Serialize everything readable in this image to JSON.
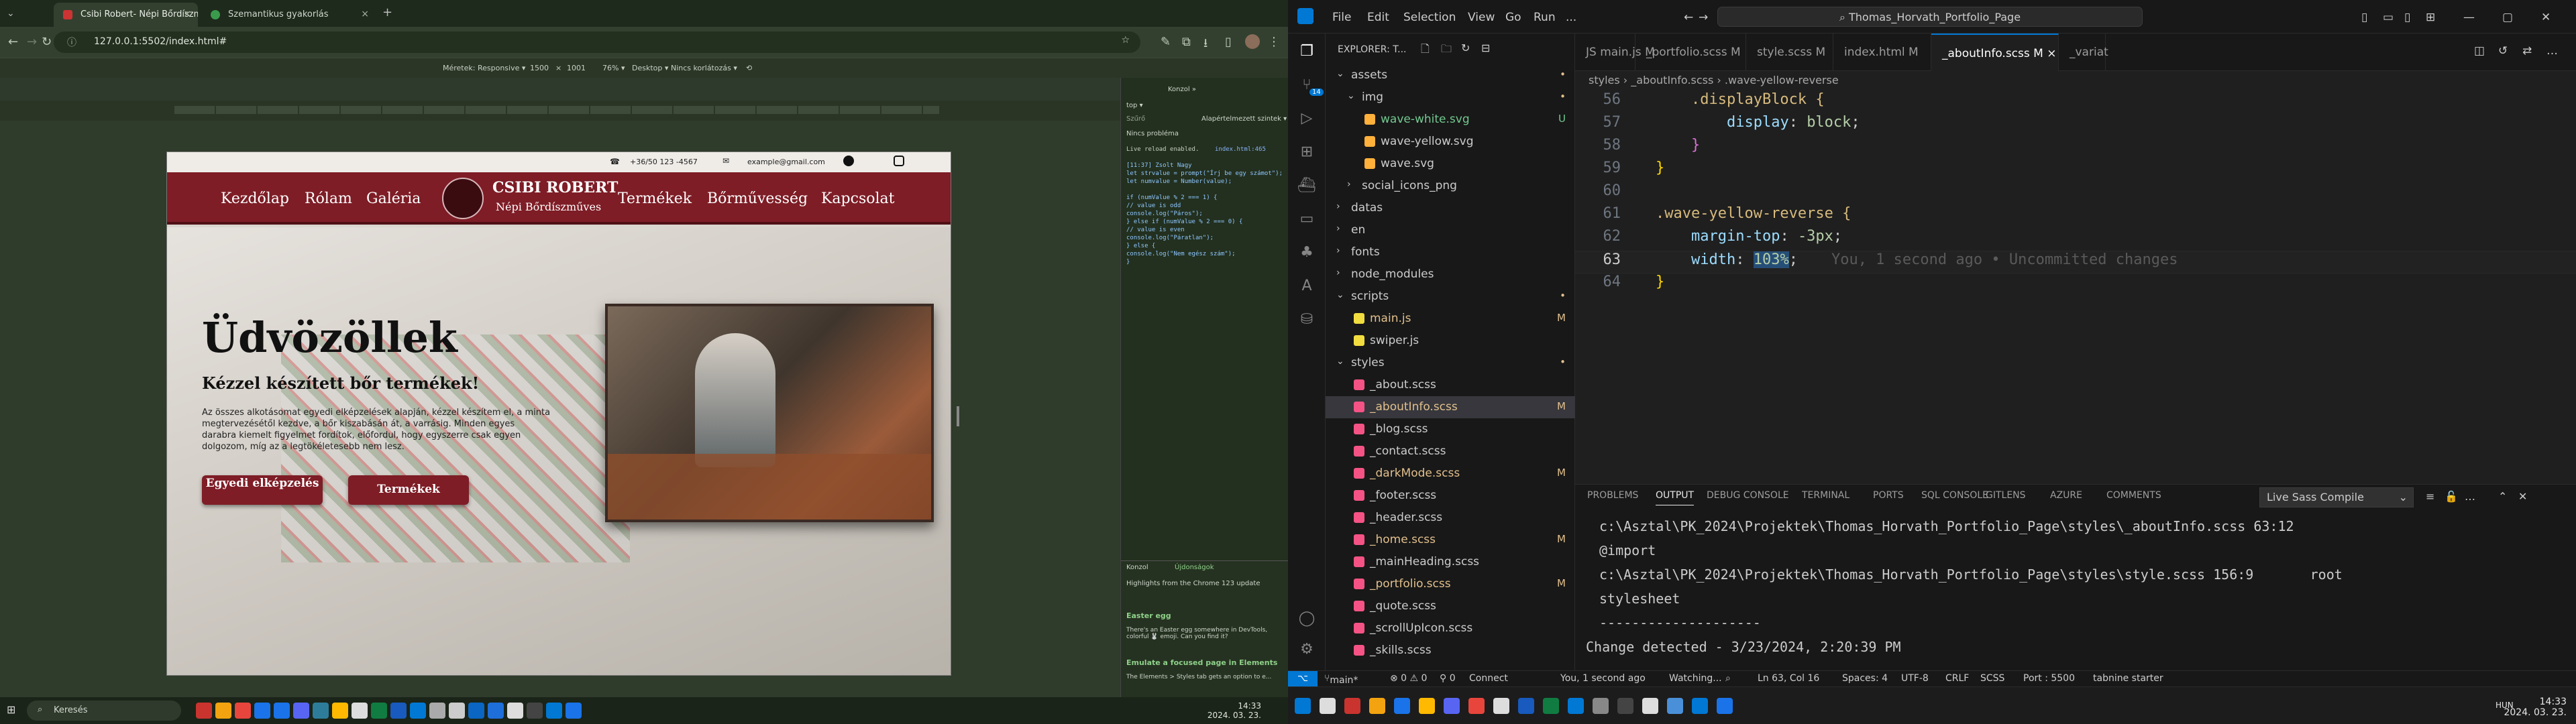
{
  "left": {
    "tabs": [
      {
        "label": "Csibi Robert- Népi Bőrdíszmű...",
        "active": true
      },
      {
        "label": "Szemantikus gyakorlás",
        "active": false
      }
    ],
    "address": "127.0.0.1:5502/index.html#",
    "devbar": {
      "dimensions": "Méretek: Responsive ▾",
      "width": "1500",
      "x": "×",
      "height": "1001",
      "zoom": "76% ▾",
      "device": "Desktop ▾",
      "throttle": "Nincs korlátozás ▾"
    },
    "website": {
      "phone": "+36/50 123 -4567",
      "email": "example@gmail.com",
      "nav": [
        "Kezdőlap",
        "Rólam",
        "Galéria",
        "Termékek",
        "Bőrművesség",
        "Kapcsolat"
      ],
      "logo_title": "CSIBI ROBERT",
      "logo_sub": "Népi Bőrdíszműves",
      "hero_title": "Üdvözöllek",
      "hero_subtitle": "Kézzel készített bőr termékek!",
      "hero_text": "Az összes alkotásomat egyedi elképzelések alapján, kézzel készítem el, a minta megtervezésétől kezdve, a bőr kiszabásán át, a varrásig. Minden egyes darabra kiemelt figyelmet fordítok, előfordul, hogy egyszerre csak egyen dolgozom, míg az a legtökéletesebb nem lesz.",
      "btn1": "Egyedi elképzelés",
      "btn2": "Termékek"
    },
    "devtools": {
      "tabs": "Konzol   »",
      "top": "top ▾",
      "filter": "Szűrő",
      "level": "Alapértelmezett szintek ▾",
      "issues": "Nincs probléma",
      "console": [
        "Live reload enabled.",
        "index.html:465",
        "[11:37] Zsolt Nagy",
        "let strvalue = prompt(\"Írj be egy számot\");",
        "let numvalue = Number(value);",
        "",
        "if (numValue % 2 === 1) {",
        "    // value is odd",
        "    console.log(\"Páros\");",
        "} else if (numValue % 2 === 0) {",
        "    // value is even",
        "    console.log(\"Páratlan\");",
        "} else {",
        "    console.log(\"Nem egész szám\");",
        "}"
      ],
      "bottom_tabs": [
        "Konzol",
        "Újdonságok"
      ],
      "bottom_head": "Highlights from the Chrome 123 update",
      "easter_title": "Easter egg",
      "easter_text": "There's an Easter egg somewhere in DevTools, colorful 🐰 emoji. Can you find it?",
      "emulate_title": "Emulate a focused page in Elements",
      "emulate_text": "The Elements > Styles tab gets an option to e..."
    },
    "taskbar": {
      "search": "Keresés",
      "time": "14:33",
      "date": "2024. 03. 23."
    }
  },
  "right": {
    "menu": [
      "File",
      "Edit",
      "Selection",
      "View",
      "Go",
      "Run",
      "..."
    ],
    "command_center": "Thomas_Horvath_Portfolio_Page",
    "explorer_title": "EXPLORER: T...",
    "tree": [
      {
        "label": "assets",
        "depth": 0,
        "type": "folder-open",
        "status": "•"
      },
      {
        "label": "img",
        "depth": 1,
        "type": "folder-open",
        "status": "•"
      },
      {
        "label": "wave-white.svg",
        "depth": 2,
        "type": "svg",
        "status": "U"
      },
      {
        "label": "wave-yellow.svg",
        "depth": 2,
        "type": "svg",
        "status": ""
      },
      {
        "label": "wave.svg",
        "depth": 2,
        "type": "svg",
        "status": ""
      },
      {
        "label": "social_icons_png",
        "depth": 1,
        "type": "folder",
        "status": ""
      },
      {
        "label": "datas",
        "depth": 0,
        "type": "folder",
        "status": ""
      },
      {
        "label": "en",
        "depth": 0,
        "type": "folder",
        "status": ""
      },
      {
        "label": "fonts",
        "depth": 0,
        "type": "folder",
        "status": ""
      },
      {
        "label": "node_modules",
        "depth": 0,
        "type": "folder",
        "status": ""
      },
      {
        "label": "scripts",
        "depth": 0,
        "type": "folder-open",
        "status": "•"
      },
      {
        "label": "main.js",
        "depth": 1,
        "type": "js",
        "status": "M"
      },
      {
        "label": "swiper.js",
        "depth": 1,
        "type": "js",
        "status": ""
      },
      {
        "label": "styles",
        "depth": 0,
        "type": "folder-open",
        "status": "•"
      },
      {
        "label": "_about.scss",
        "depth": 1,
        "type": "scss",
        "status": ""
      },
      {
        "label": "_aboutInfo.scss",
        "depth": 1,
        "type": "scss",
        "status": "M",
        "selected": true
      },
      {
        "label": "_blog.scss",
        "depth": 1,
        "type": "scss",
        "status": ""
      },
      {
        "label": "_contact.scss",
        "depth": 1,
        "type": "scss",
        "status": ""
      },
      {
        "label": "_darkMode.scss",
        "depth": 1,
        "type": "scss",
        "status": "M"
      },
      {
        "label": "_footer.scss",
        "depth": 1,
        "type": "scss",
        "status": ""
      },
      {
        "label": "_header.scss",
        "depth": 1,
        "type": "scss",
        "status": ""
      },
      {
        "label": "_home.scss",
        "depth": 1,
        "type": "scss",
        "status": "M"
      },
      {
        "label": "_mainHeading.scss",
        "depth": 1,
        "type": "scss",
        "status": ""
      },
      {
        "label": "_portfolio.scss",
        "depth": 1,
        "type": "scss",
        "status": "M"
      },
      {
        "label": "_quote.scss",
        "depth": 1,
        "type": "scss",
        "status": ""
      },
      {
        "label": "_scrollUpIcon.scss",
        "depth": 1,
        "type": "scss",
        "status": ""
      },
      {
        "label": "_skills.scss",
        "depth": 1,
        "type": "scss",
        "status": ""
      }
    ],
    "editor_tabs": [
      {
        "label": "JS main.js  M"
      },
      {
        "label": "_portfolio.scss  M"
      },
      {
        "label": "style.scss  M"
      },
      {
        "label": "index.html  M"
      },
      {
        "label": "_aboutInfo.scss  M  ×",
        "active": true
      },
      {
        "label": "_variat"
      }
    ],
    "breadcrumb": "styles  ›  _aboutInfo.scss  ›  .wave-yellow-reverse",
    "code": [
      {
        "n": "56",
        "indent": "    ",
        "text": ".displayBlock {",
        "color": "#d7ba7d"
      },
      {
        "n": "57",
        "indent": "        ",
        "prop": "display",
        "val": "block",
        "color": "#9cdcfe"
      },
      {
        "n": "58",
        "indent": "    ",
        "text": "}",
        "color": "#da70d6"
      },
      {
        "n": "59",
        "indent": "",
        "text": "}",
        "color": "#ffd700"
      },
      {
        "n": "60",
        "indent": "",
        "text": "",
        "color": "#ccc"
      },
      {
        "n": "61",
        "indent": "",
        "text": ".wave-yellow-reverse {",
        "color": "#d7ba7d"
      },
      {
        "n": "62",
        "indent": "    ",
        "prop": "margin-top",
        "val": "-3px",
        "color": "#9cdcfe"
      },
      {
        "n": "63",
        "indent": "    ",
        "prop": "width",
        "val": "103%",
        "color": "#9cdcfe",
        "blame": "You, 1 second ago • Uncommitted changes",
        "current": true
      },
      {
        "n": "64",
        "indent": "",
        "text": "}",
        "color": "#ffd700"
      }
    ],
    "panel_tabs": [
      "PROBLEMS",
      "OUTPUT",
      "DEBUG CONSOLE",
      "TERMINAL",
      "PORTS",
      "SQL CONSOLE",
      "GITLENS",
      "AZURE",
      "COMMENTS"
    ],
    "panel_active": "OUTPUT",
    "output_channel": "Live Sass Compile",
    "output": [
      "c:\\Asztal\\PK_2024\\Projektek\\Thomas_Horvath_Portfolio_Page\\styles\\_aboutInfo.scss 63:12",
      "@import",
      "c:\\Asztal\\PK_2024\\Projektek\\Thomas_Horvath_Portfolio_Page\\styles\\style.scss 156:9       root",
      "stylesheet",
      "--------------------",
      "Change detected - 3/23/2024, 2:20:39 PM"
    ],
    "status": {
      "branch": "main*",
      "errors": "⊗ 0 ⚠ 0",
      "ports": "⚲ 0",
      "connect": "Connect",
      "blame": "You, 1 second ago",
      "watching": "Watching...",
      "position": "Ln 63, Col 16",
      "spaces": "Spaces: 4",
      "encoding": "UTF-8",
      "eol": "CRLF",
      "lang": "SCSS",
      "port": "Port : 5500",
      "tabnine": "tabnine starter"
    },
    "taskbar": {
      "lang": "HUN",
      "time": "14:33",
      "date": "2024. 03. 23."
    }
  }
}
